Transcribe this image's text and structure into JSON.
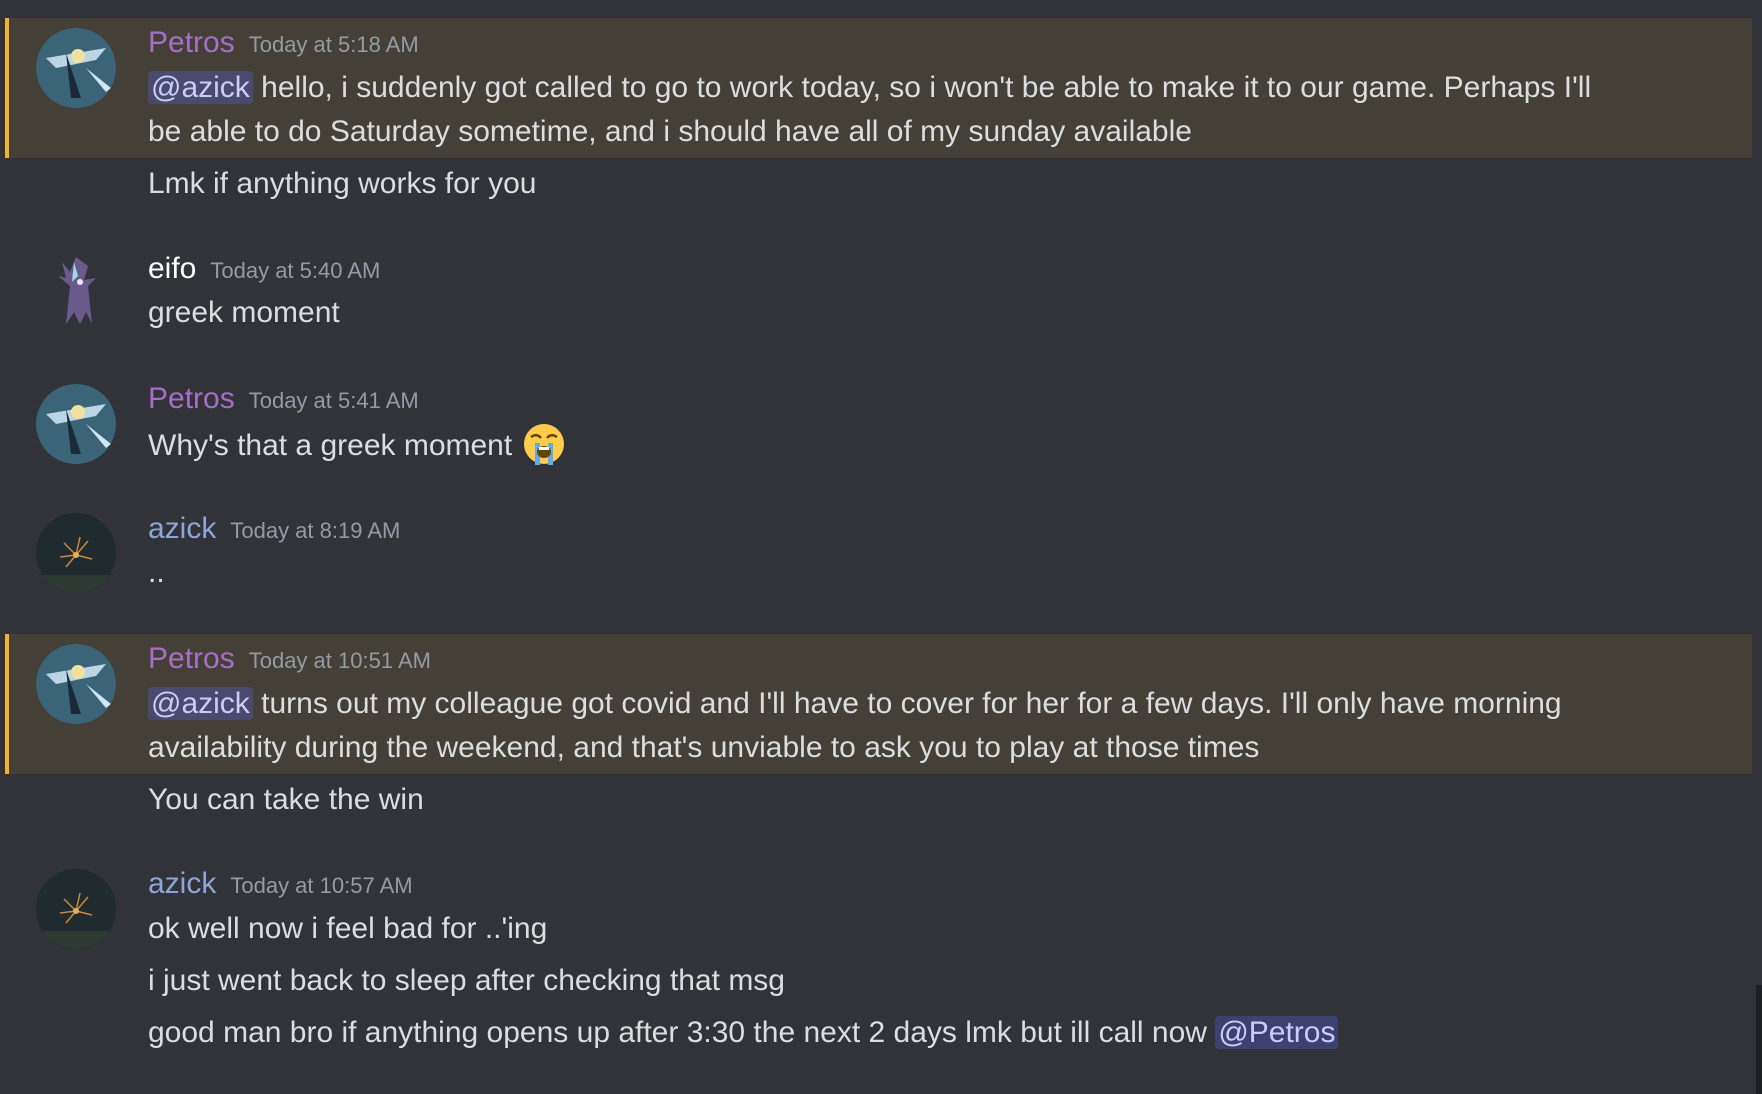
{
  "colors": {
    "background": "#313338",
    "petros_name": "#a66fc7",
    "eifo_name": "#ffffff",
    "azick_name": "#8fa4d9",
    "timestamp": "#949ba4",
    "mention_bg": "#4a4f7c",
    "highlight_bg": "#444037",
    "highlight_bar": "#f0b232"
  },
  "messages": [
    {
      "author": "Petros",
      "timestamp": "Today at 5:18 AM",
      "mention": "@azick",
      "line1": "hello, i suddenly got called to go to work today, so i won't be able to make it to our game. Perhaps I'll",
      "line2": "be able to do Saturday sometime, and i should have all of my sunday available",
      "followup": "Lmk if anything works for you"
    },
    {
      "author": "eifo",
      "timestamp": "Today at 5:40 AM",
      "text": "greek moment"
    },
    {
      "author": "Petros",
      "timestamp": "Today at 5:41 AM",
      "text": "Why's that a greek moment",
      "emoji": "loudly-crying-face"
    },
    {
      "author": "azick",
      "timestamp": "Today at 8:19 AM",
      "text": ".."
    },
    {
      "author": "Petros",
      "timestamp": "Today at 10:51 AM",
      "mention": "@azick",
      "line1": "turns out my colleague got covid and I'll have to cover for her for a few days. I'll only have morning",
      "line2": "availability during the weekend, and that's unviable to ask you to play at those times",
      "followup": "You can take the win"
    },
    {
      "author": "azick",
      "timestamp": "Today at 10:57 AM",
      "lines": [
        "ok well now i feel bad for ..'ing",
        "i just went back to sleep after checking that msg",
        "good man bro if anything opens up after 3:30 the next 2 days lmk but ill call now"
      ],
      "mention": "@Petros"
    }
  ]
}
